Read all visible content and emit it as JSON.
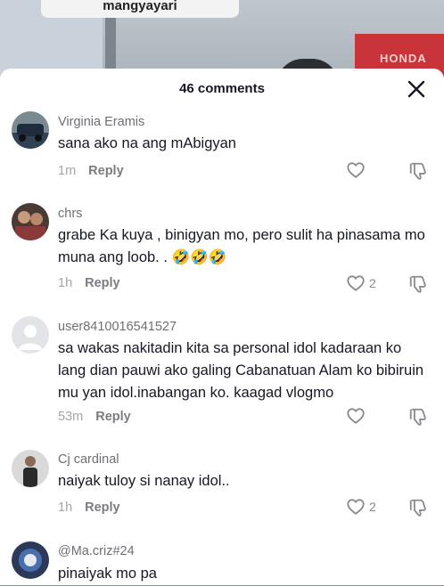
{
  "video": {
    "caption": "mangyayari",
    "sign": "HONDA"
  },
  "sheet": {
    "title": "46 comments"
  },
  "comments": [
    {
      "username": "Virginia Eramis",
      "text": "sana ako na ang mAbigyan",
      "time": "1m",
      "reply": "Reply",
      "likes": ""
    },
    {
      "username": "chrs",
      "text": "grabe Ka kuya , binigyan mo, pero sulit ha pinasama mo muna ang loob. . 🤣🤣🤣",
      "time": "1h",
      "reply": "Reply",
      "likes": "2"
    },
    {
      "username": "user8410016541527",
      "text": "sa wakas nakitadin kita sa personal idol kadaraan ko lang dian pauwi ako galing Cabanatuan Alam ko bibiruin mu yan idol.inabangan ko. kaagad vlogmo",
      "time": "53m",
      "reply": "Reply",
      "likes": ""
    },
    {
      "username": "Cj cardinal",
      "text": "naiyak tuloy si nanay idol..",
      "time": "1h",
      "reply": "Reply",
      "likes": "2"
    },
    {
      "username": "@Ma.criz#24",
      "text": "pinaiyak mo pa",
      "time": "",
      "reply": "",
      "likes": ""
    }
  ]
}
